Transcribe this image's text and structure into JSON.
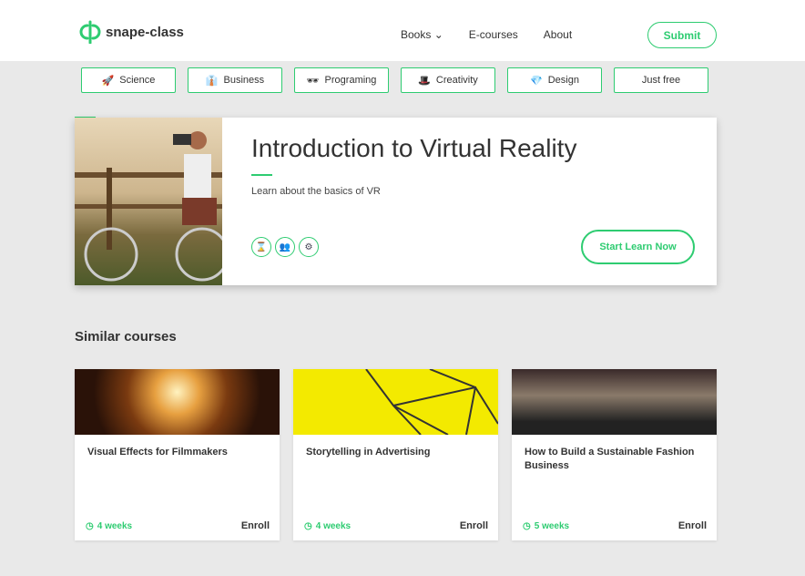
{
  "brand": {
    "name": "snape-class",
    "accent": "#2ecc71"
  },
  "nav": {
    "items": [
      "Books",
      "E-courses",
      "About"
    ],
    "submit": "Submit"
  },
  "categories": [
    {
      "icon": "🚀",
      "label": "Science"
    },
    {
      "icon": "👔",
      "label": "Business"
    },
    {
      "icon": "🕶",
      "label": "Programing"
    },
    {
      "icon": "🎩",
      "label": "Creativity"
    },
    {
      "icon": "💎",
      "label": "Design"
    },
    {
      "icon": "",
      "label": "Just free"
    }
  ],
  "hero": {
    "title": "Introduction to Virtual Reality",
    "subtitle": "Learn about the basics of VR",
    "cta": "Start Learn Now",
    "icons": [
      "hourglass-icon",
      "people-icon",
      "sliders-icon"
    ]
  },
  "similar": {
    "heading": "Similar courses",
    "courses": [
      {
        "title": "Visual Effects for Filmmakers",
        "duration": "4 weeks",
        "action": "Enroll"
      },
      {
        "title": "Storytelling in Advertising",
        "duration": "4 weeks",
        "action": "Enroll"
      },
      {
        "title": "How to Build a Sustainable Fashion Business",
        "duration": "5 weeks",
        "action": "Enroll"
      }
    ]
  }
}
